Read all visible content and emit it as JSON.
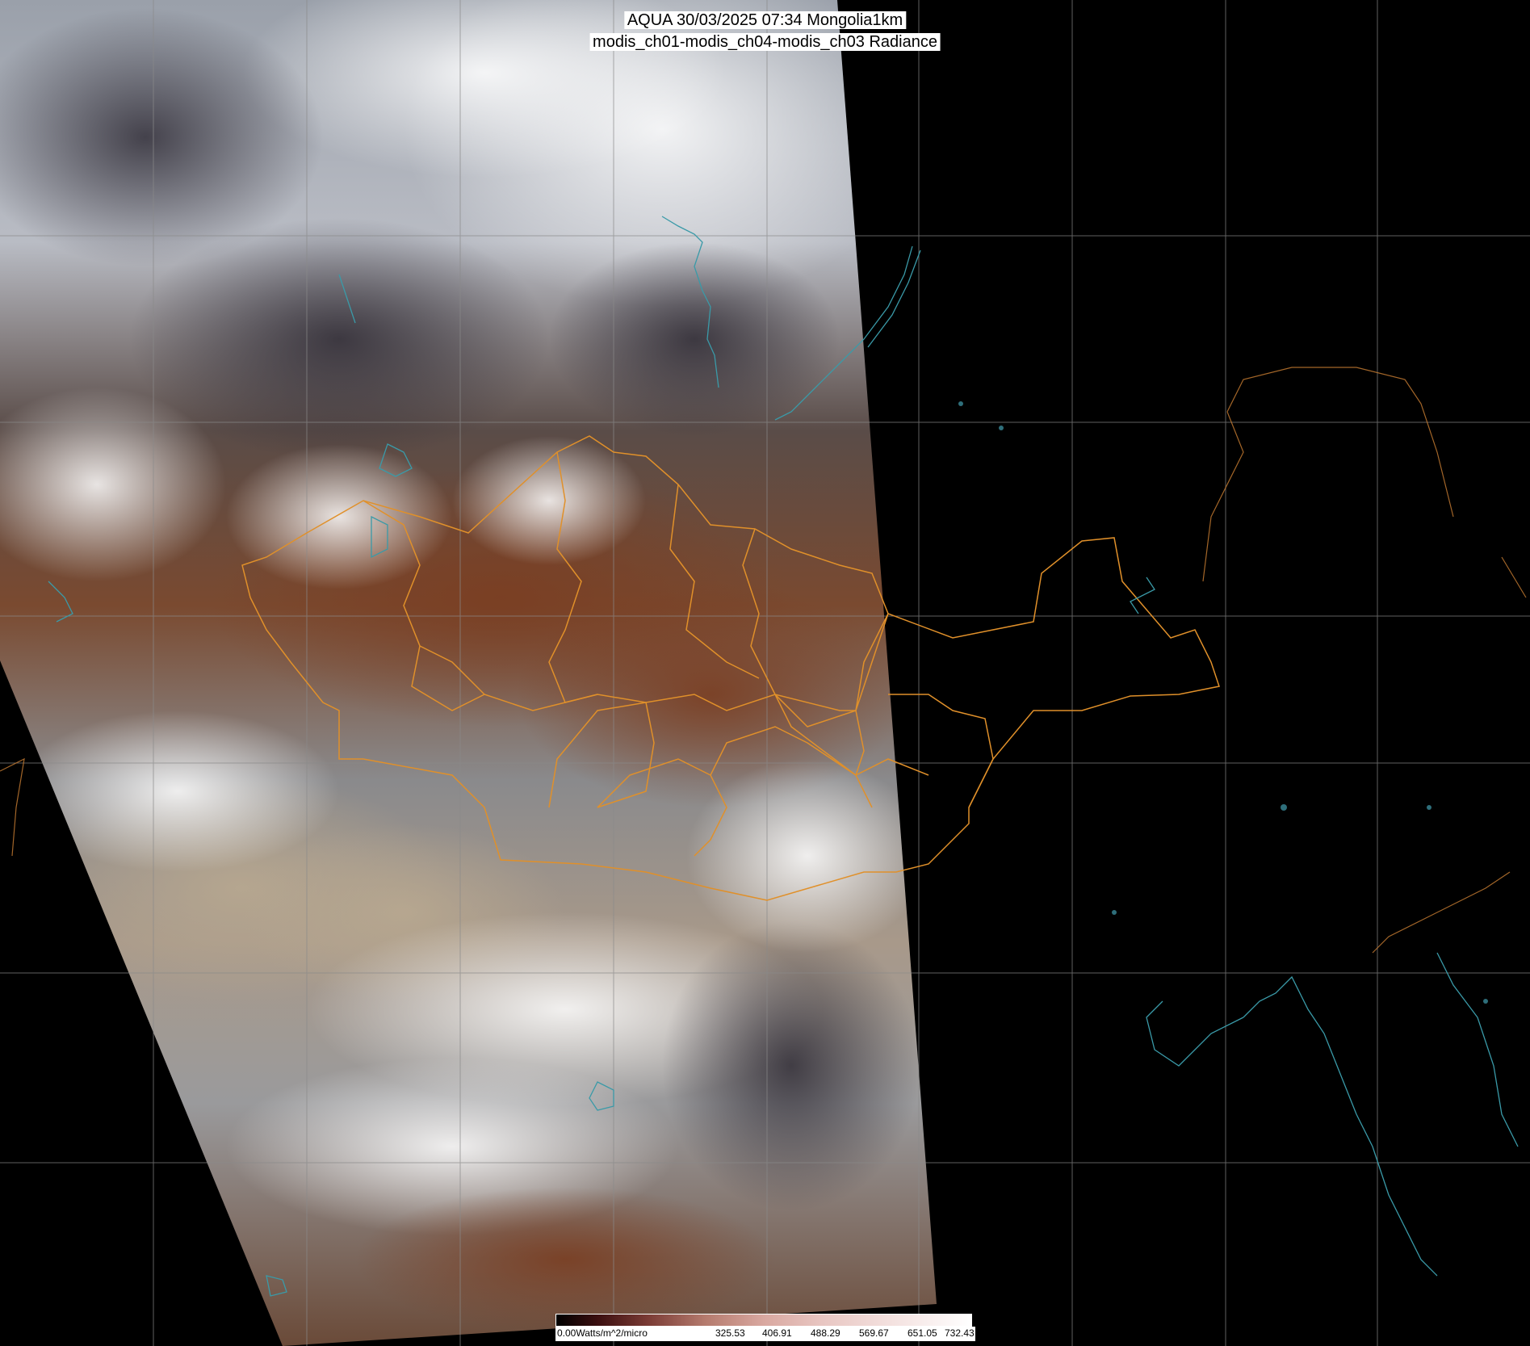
{
  "title_line1": "AQUA 30/03/2025 07:34 Mongolia1km",
  "title_line2": "modis_ch01-modis_ch04-modis_ch03 Radiance",
  "colorbar": {
    "labels": [
      "0.00Watts/m^2/micro",
      "325.53",
      "406.91",
      "488.29",
      "569.67",
      "651.05",
      "732.43"
    ]
  },
  "colors": {
    "background": "#000000",
    "grid": "#8a8a8a",
    "border": "#e0902a",
    "coast": "#3a9aa8"
  }
}
